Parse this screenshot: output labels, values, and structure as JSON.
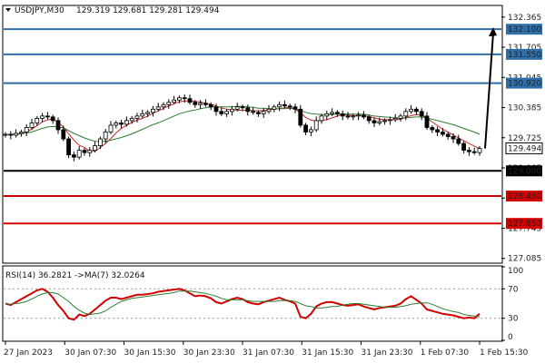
{
  "header": {
    "symbol": "USDJPY,M30",
    "ohlc": "129.319 129.681 129.281 129.494",
    "rsi_label": "RSI(14) 36.2821 ->MA(7) 32.0264"
  },
  "colors": {
    "background": "#ffffff",
    "resistance_line": "#2e6fa7",
    "support_line": "#d40000",
    "pivot_line": "#000000",
    "ma_fast": "#c62828",
    "ma_slow": "#2e7d32",
    "candle": "#000000",
    "rsi_line": "#d40000",
    "rsi_ma": "#2e7d32",
    "level_box_blue": "#2e6fa7",
    "level_box_red": "#d40000",
    "level_box_black": "#000000"
  },
  "chart_data": [
    {
      "type": "line",
      "name": "price",
      "price_axis_ticks": [
        "132.365",
        "131.705",
        "131.045",
        "130.385",
        "129.725",
        "129.065",
        "128.405",
        "127.745",
        "127.085"
      ],
      "ylim": [
        127.0,
        132.6
      ],
      "time_axis_labels": [
        "27 Jan 2023",
        "30 Jan 07:30",
        "30 Jan 15:30",
        "30 Jan 23:30",
        "31 Jan 07:30",
        "31 Jan 15:30",
        "31 Jan 23:30",
        "1 Feb 07:30",
        "1 Feb 15:30"
      ],
      "current_price": "129.494",
      "levels": [
        {
          "price": 132.1,
          "label": "132.100",
          "kind": "resistance"
        },
        {
          "price": 131.55,
          "label": "131.550",
          "kind": "resistance"
        },
        {
          "price": 130.92,
          "label": "130.920",
          "kind": "resistance"
        },
        {
          "price": 129.0,
          "label": "129.000",
          "kind": "pivot"
        },
        {
          "price": 128.45,
          "label": "128.450",
          "kind": "support"
        },
        {
          "price": 127.85,
          "label": "127.850",
          "kind": "support"
        }
      ],
      "close": [
        129.8,
        129.78,
        129.82,
        129.85,
        129.95,
        130.05,
        130.15,
        130.2,
        130.18,
        130.1,
        129.9,
        129.7,
        129.35,
        129.3,
        129.45,
        129.4,
        129.45,
        129.55,
        129.7,
        129.85,
        130.0,
        130.05,
        130.02,
        130.1,
        130.15,
        130.2,
        130.25,
        130.28,
        130.35,
        130.4,
        130.45,
        130.5,
        130.55,
        130.6,
        130.58,
        130.5,
        130.45,
        130.48,
        130.45,
        130.4,
        130.3,
        130.25,
        130.3,
        130.35,
        130.4,
        130.38,
        130.3,
        130.28,
        130.25,
        130.3,
        130.35,
        130.4,
        130.45,
        130.42,
        130.4,
        130.35,
        130.0,
        129.85,
        129.9,
        130.1,
        130.2,
        130.25,
        130.28,
        130.25,
        130.2,
        130.18,
        130.2,
        130.22,
        130.18,
        130.1,
        130.05,
        130.08,
        130.1,
        130.12,
        130.15,
        130.2,
        130.3,
        130.35,
        130.3,
        130.2,
        129.95,
        129.9,
        129.85,
        129.8,
        129.75,
        129.7,
        129.6,
        129.45,
        129.42,
        129.4,
        129.49
      ],
      "series": [
        {
          "name": "MA fast",
          "values": [
            129.8,
            129.8,
            129.81,
            129.82,
            129.86,
            129.91,
            129.99,
            130.07,
            130.12,
            130.13,
            130.07,
            129.96,
            129.81,
            129.67,
            129.56,
            129.51,
            129.43,
            129.43,
            129.51,
            129.6,
            129.71,
            129.83,
            129.93,
            130.0,
            130.06,
            130.11,
            130.15,
            130.2,
            130.26,
            130.31,
            130.37,
            130.42,
            130.47,
            130.51,
            130.53,
            130.53,
            130.52,
            130.51,
            130.48,
            130.46,
            130.42,
            130.38,
            130.35,
            130.33,
            130.33,
            130.32,
            130.33,
            130.32,
            130.31,
            130.32,
            130.33,
            130.35,
            130.36,
            130.38,
            130.39,
            130.35,
            130.27,
            130.17,
            130.11,
            130.09,
            130.1,
            130.12,
            130.16,
            130.2,
            130.23,
            130.22,
            130.21,
            130.21,
            130.21,
            130.19,
            130.16,
            130.13,
            130.12,
            130.12,
            130.12,
            130.13,
            130.17,
            130.21,
            130.23,
            130.22,
            130.15,
            130.07,
            129.99,
            129.91,
            129.85,
            129.79,
            129.72,
            129.66,
            129.6,
            129.54,
            129.49
          ]
        },
        {
          "name": "MA slow",
          "values": [
            129.8,
            129.8,
            129.8,
            129.81,
            129.83,
            129.85,
            129.89,
            129.93,
            129.96,
            129.97,
            129.96,
            129.94,
            129.88,
            129.82,
            129.77,
            129.72,
            129.68,
            129.65,
            129.64,
            129.65,
            129.67,
            129.7,
            129.73,
            129.77,
            129.81,
            129.86,
            129.91,
            129.96,
            130.01,
            130.05,
            130.1,
            130.15,
            130.2,
            130.25,
            130.28,
            130.31,
            130.33,
            130.36,
            130.38,
            130.4,
            130.4,
            130.4,
            130.4,
            130.4,
            130.41,
            130.41,
            130.4,
            130.39,
            130.37,
            130.37,
            130.36,
            130.36,
            130.36,
            130.36,
            130.37,
            130.35,
            130.32,
            130.28,
            130.25,
            130.24,
            130.23,
            130.23,
            130.23,
            130.24,
            130.24,
            130.24,
            130.24,
            130.24,
            130.24,
            130.22,
            130.2,
            130.19,
            130.18,
            130.17,
            130.16,
            130.16,
            130.16,
            130.17,
            130.18,
            130.18,
            130.15,
            130.13,
            130.1,
            130.07,
            130.04,
            130.01,
            129.97,
            129.93,
            129.89,
            129.85,
            129.8
          ]
        }
      ],
      "projection": {
        "from": 129.49,
        "to": 132.1
      }
    },
    {
      "type": "line",
      "name": "RSI",
      "ylim": [
        0,
        100
      ],
      "ticks": [
        "100",
        "70",
        "30",
        "0"
      ],
      "reference_levels": [
        70,
        30
      ],
      "series": [
        {
          "name": "RSI(14)",
          "values": [
            50,
            48,
            52,
            56,
            60,
            64,
            68,
            70,
            66,
            58,
            48,
            40,
            30,
            28,
            35,
            33,
            36,
            42,
            48,
            54,
            58,
            58,
            56,
            58,
            60,
            62,
            62,
            63,
            64,
            66,
            67,
            68,
            69,
            70,
            68,
            64,
            60,
            61,
            60,
            57,
            52,
            50,
            53,
            56,
            58,
            56,
            52,
            50,
            49,
            52,
            54,
            56,
            58,
            55,
            53,
            50,
            32,
            30,
            36,
            46,
            50,
            52,
            52,
            50,
            48,
            47,
            48,
            49,
            46,
            44,
            42,
            44,
            45,
            46,
            47,
            50,
            56,
            60,
            55,
            50,
            42,
            40,
            38,
            36,
            35,
            34,
            32,
            30,
            31,
            30,
            36
          ]
        },
        {
          "name": "MA(7)",
          "values": [
            50,
            49,
            50,
            51,
            53,
            56,
            60,
            63,
            65,
            65,
            63,
            58,
            53,
            46,
            41,
            37,
            35,
            36,
            37,
            40,
            45,
            49,
            53,
            55,
            57,
            58,
            59,
            60,
            61,
            62,
            63,
            64,
            65,
            67,
            67,
            67,
            66,
            65,
            64,
            62,
            60,
            57,
            55,
            55,
            55,
            55,
            54,
            53,
            53,
            53,
            53,
            53,
            54,
            54,
            54,
            53,
            50,
            47,
            46,
            44,
            44,
            45,
            46,
            46,
            48,
            49,
            50,
            50,
            49,
            48,
            47,
            46,
            45,
            45,
            45,
            46,
            47,
            49,
            50,
            51,
            51,
            49,
            46,
            43,
            41,
            39,
            38,
            35,
            34,
            33,
            32
          ]
        }
      ]
    }
  ]
}
